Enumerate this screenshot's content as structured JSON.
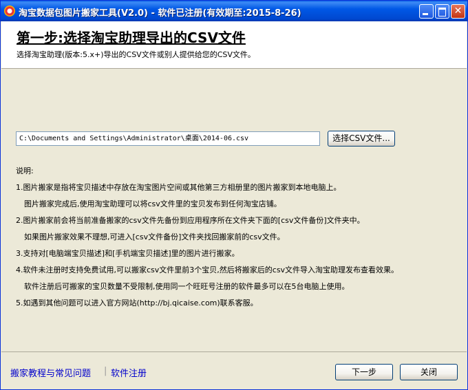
{
  "window": {
    "title": "淘宝数据包图片搬家工具(V2.0) - 软件已注册(有效期至:2015-8-26)"
  },
  "header": {
    "title": "第一步:选择淘宝助理导出的CSV文件",
    "subtitle": "选择淘宝助理(版本:5.x+)导出的CSV文件或别人提供给您的CSV文件。"
  },
  "file_picker": {
    "path": "C:\\Documents and Settings\\Administrator\\桌面\\2014-06.csv",
    "browse_label": "选择CSV文件..."
  },
  "description": {
    "heading": "说明:",
    "lines": [
      "1.图片搬家是指将宝贝描述中存放在淘宝图片空间或其他第三方相册里的图片搬家到本地电脑上。",
      "图片搬家完成后,使用淘宝助理可以将csv文件里的宝贝发布到任何淘宝店铺。",
      "2.图片搬家前会将当前准备搬家的csv文件先备份到应用程序所在文件夹下面的[csv文件备份]文件夹中。",
      "如果图片搬家效果不理想,可进入[csv文件备份]文件夹找回搬家前的csv文件。",
      "3.支持对[电脑端宝贝描述]和[手机端宝贝描述]里的图片进行搬家。",
      "4.软件未注册时支持免费试用,可以搬家csv文件里前3个宝贝,然后将搬家后的csv文件导入淘宝助理发布查看效果。",
      "软件注册后可搬家的宝贝数量不受限制,使用同一个旺旺号注册的软件最多可以在5台电脑上使用。",
      "5.如遇到其他问题可以进入官方网站(http://bj.qicaise.com)联系客服。"
    ]
  },
  "footer": {
    "tutorial_link": "搬家教程与常见问题",
    "separator": "|",
    "register_link": "软件注册",
    "next_label": "下一步",
    "close_label": "关闭"
  }
}
